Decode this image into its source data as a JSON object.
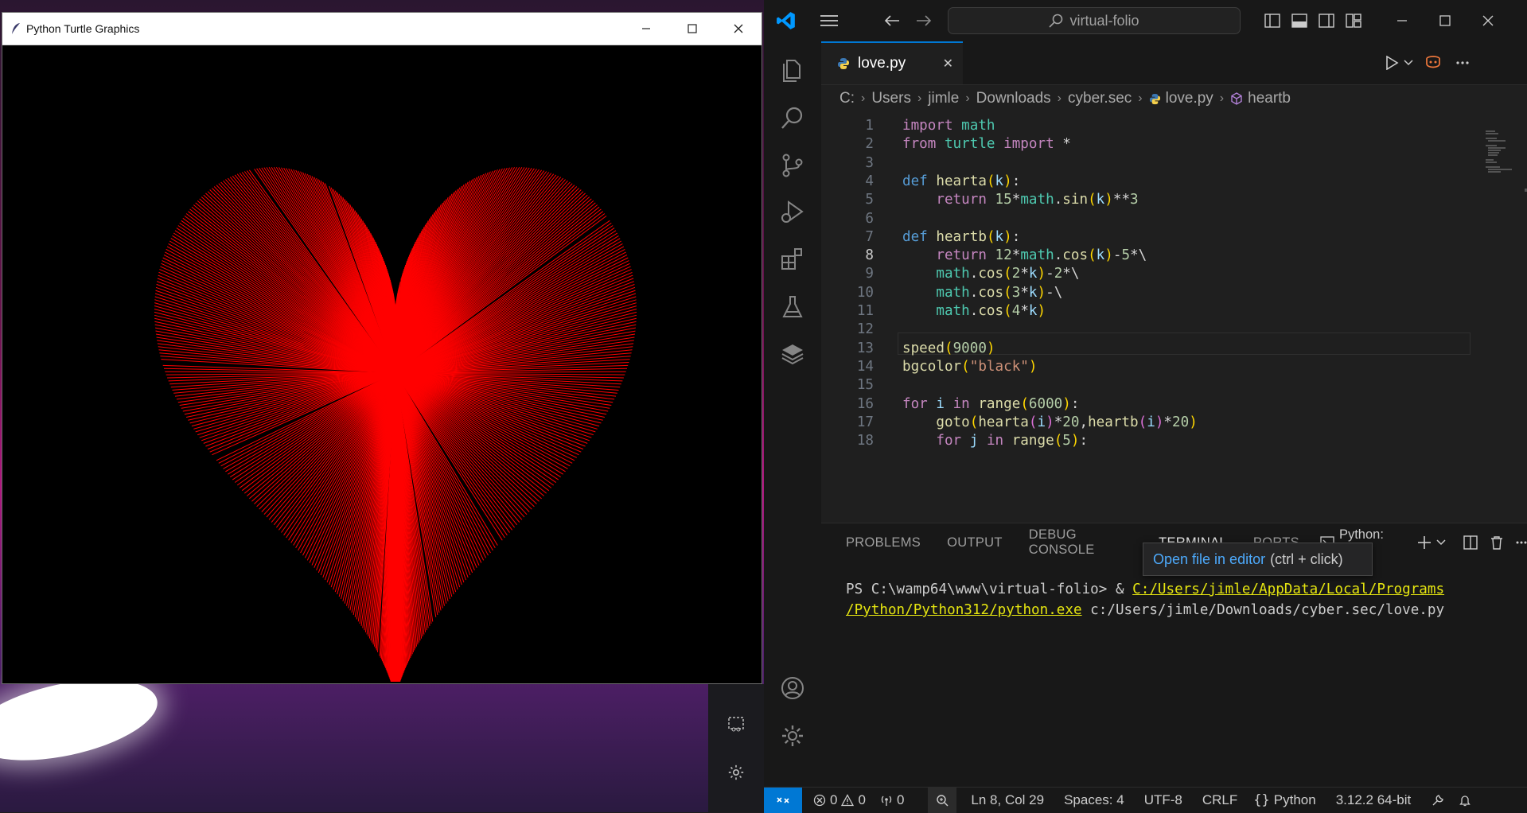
{
  "turtle_window": {
    "title": "Python Turtle Graphics"
  },
  "vscode": {
    "search_placeholder": "virtual-folio",
    "tab": {
      "label": "love.py",
      "close": "✕"
    },
    "breadcrumb": [
      "C:",
      "Users",
      "jimle",
      "Downloads",
      "cyber.sec",
      "love.py",
      "heartb"
    ],
    "code_lines": [
      {
        "n": "1",
        "html": "import math"
      },
      {
        "n": "2",
        "html": "from turtle import *"
      },
      {
        "n": "3",
        "html": ""
      },
      {
        "n": "4",
        "html": "def hearta(k):"
      },
      {
        "n": "5",
        "html": "    return 15*math.sin(k)**3"
      },
      {
        "n": "6",
        "html": ""
      },
      {
        "n": "7",
        "html": "def heartb(k):"
      },
      {
        "n": "8",
        "html": "    return 12*math.cos(k)-5*\\"
      },
      {
        "n": "9",
        "html": "    math.cos(2*k)-2*\\"
      },
      {
        "n": "10",
        "html": "    math.cos(3*k)-\\"
      },
      {
        "n": "11",
        "html": "    math.cos(4*k)"
      },
      {
        "n": "12",
        "html": ""
      },
      {
        "n": "13",
        "html": "speed(9000)"
      },
      {
        "n": "14",
        "html": "bgcolor(\"black\")"
      },
      {
        "n": "15",
        "html": ""
      },
      {
        "n": "16",
        "html": "for i in range(6000):"
      },
      {
        "n": "17",
        "html": "    goto(hearta(i)*20,heartb(i)*20)"
      },
      {
        "n": "18",
        "html": "    for j in range(5):"
      }
    ],
    "active_line": "8",
    "panel_tabs": [
      "PROBLEMS",
      "OUTPUT",
      "DEBUG CONSOLE",
      "TERMINAL",
      "PORTS"
    ],
    "panel_terminal_name": "Python: love",
    "tooltip": {
      "link": "Open file in editor",
      "hint": "(ctrl + click)"
    },
    "terminal": {
      "prompt": "PS C:\\wamp64\\www\\virtual-folio> & ",
      "exe_line1": "C:/Users/jimle/AppData/Local/Programs",
      "exe_line2": "/Python/Python312/python.exe",
      "arg": " c:/Users/jimle/Downloads/cyber.sec/love.py"
    },
    "statusbar": {
      "errors": "0",
      "warnings": "0",
      "ports": "0",
      "position": "Ln 8, Col 29",
      "spaces": "Spaces: 4",
      "encoding": "UTF-8",
      "eol": "CRLF",
      "language": "Python",
      "interpreter": "3.12.2 64-bit"
    }
  },
  "colors": {
    "accent": "#0078d4",
    "heart": "#ff0000"
  }
}
